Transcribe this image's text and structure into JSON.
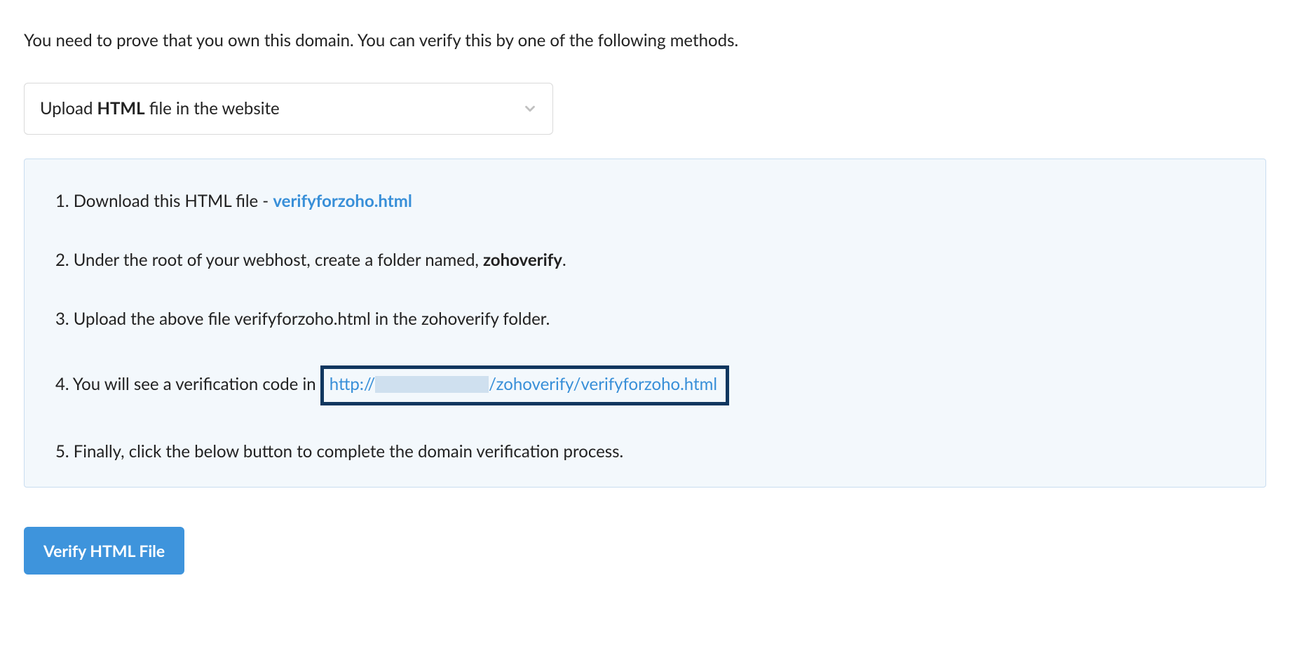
{
  "intro": "You need to prove that you own this domain. You can verify this by one of the following methods.",
  "select": {
    "prefix": "Upload ",
    "bold": "HTML",
    "suffix": " file in the website"
  },
  "steps": {
    "s1_prefix": "1. Download this HTML file - ",
    "s1_link": "verifyforzoho.html",
    "s2_prefix": "2. Under the root of your webhost, create a folder named, ",
    "s2_bold": "zohoverify",
    "s2_suffix": ".",
    "s3": "3. Upload the above file verifyforzoho.html in the zohoverify folder.",
    "s4_prefix": "4. You will see a verification code in ",
    "s4_url_protocol": "http://",
    "s4_url_path": "/zohoverify/verifyforzoho.html",
    "s5": "5. Finally, click the below button to complete the domain verification process."
  },
  "button": {
    "label": "Verify HTML File"
  }
}
